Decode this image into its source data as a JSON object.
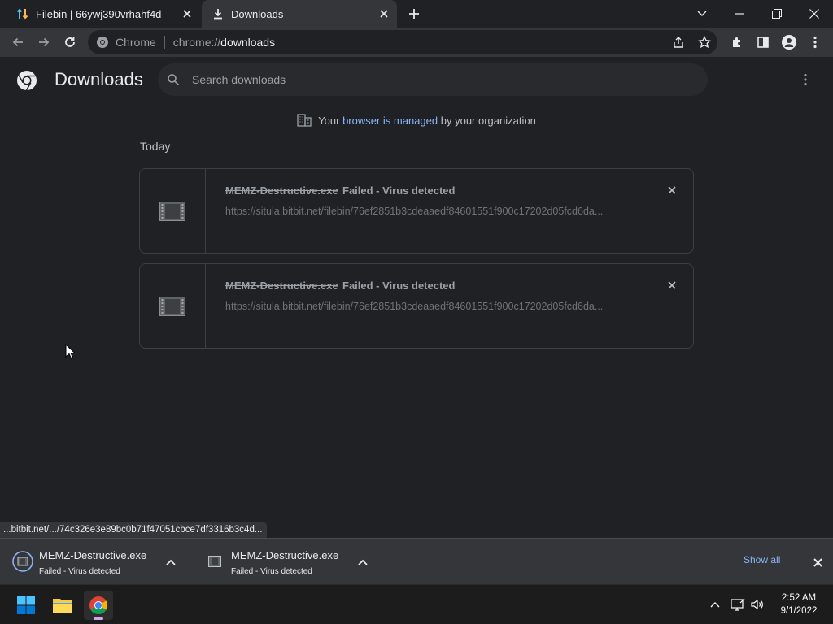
{
  "tabs": [
    {
      "label": "Filebin | 66ywj390vrhahf4d",
      "icon": "filebin-arrows-icon",
      "active": false
    },
    {
      "label": "Downloads",
      "icon": "download-icon",
      "active": true
    }
  ],
  "omnibox": {
    "site_label": "Chrome",
    "url_scheme": "chrome://",
    "url_host": "downloads"
  },
  "page": {
    "title": "Downloads",
    "search_placeholder": "Search downloads",
    "managed": {
      "prefix": "Your",
      "link": "browser is managed",
      "suffix": "by your organization"
    },
    "section_label": "Today",
    "downloads": [
      {
        "name": "MEMZ-Destructive.exe",
        "status": "Failed - Virus detected",
        "url": "https://situla.bitbit.net/filebin/76ef2851b3cdeaaedf84601551f900c17202d05fcd6da..."
      },
      {
        "name": "MEMZ-Destructive.exe",
        "status": "Failed - Virus detected",
        "url": "https://situla.bitbit.net/filebin/76ef2851b3cdeaaedf84601551f900c17202d05fcd6da..."
      }
    ]
  },
  "status_bubble": "...bitbit.net/.../74c326e3e89bc0b71f47051cbce7df3316b3c4d...",
  "shelf": {
    "items": [
      {
        "name": "MEMZ-Destructive.exe",
        "status": "Failed - Virus detected"
      },
      {
        "name": "MEMZ-Destructive.exe",
        "status": "Failed - Virus detected"
      }
    ],
    "show_all": "Show all"
  },
  "taskbar": {
    "time": "2:52 AM",
    "date": "9/1/2022"
  },
  "colors": {
    "accent_link": "#8ab4f8",
    "background": "#202124",
    "toolbar": "#35363a"
  }
}
